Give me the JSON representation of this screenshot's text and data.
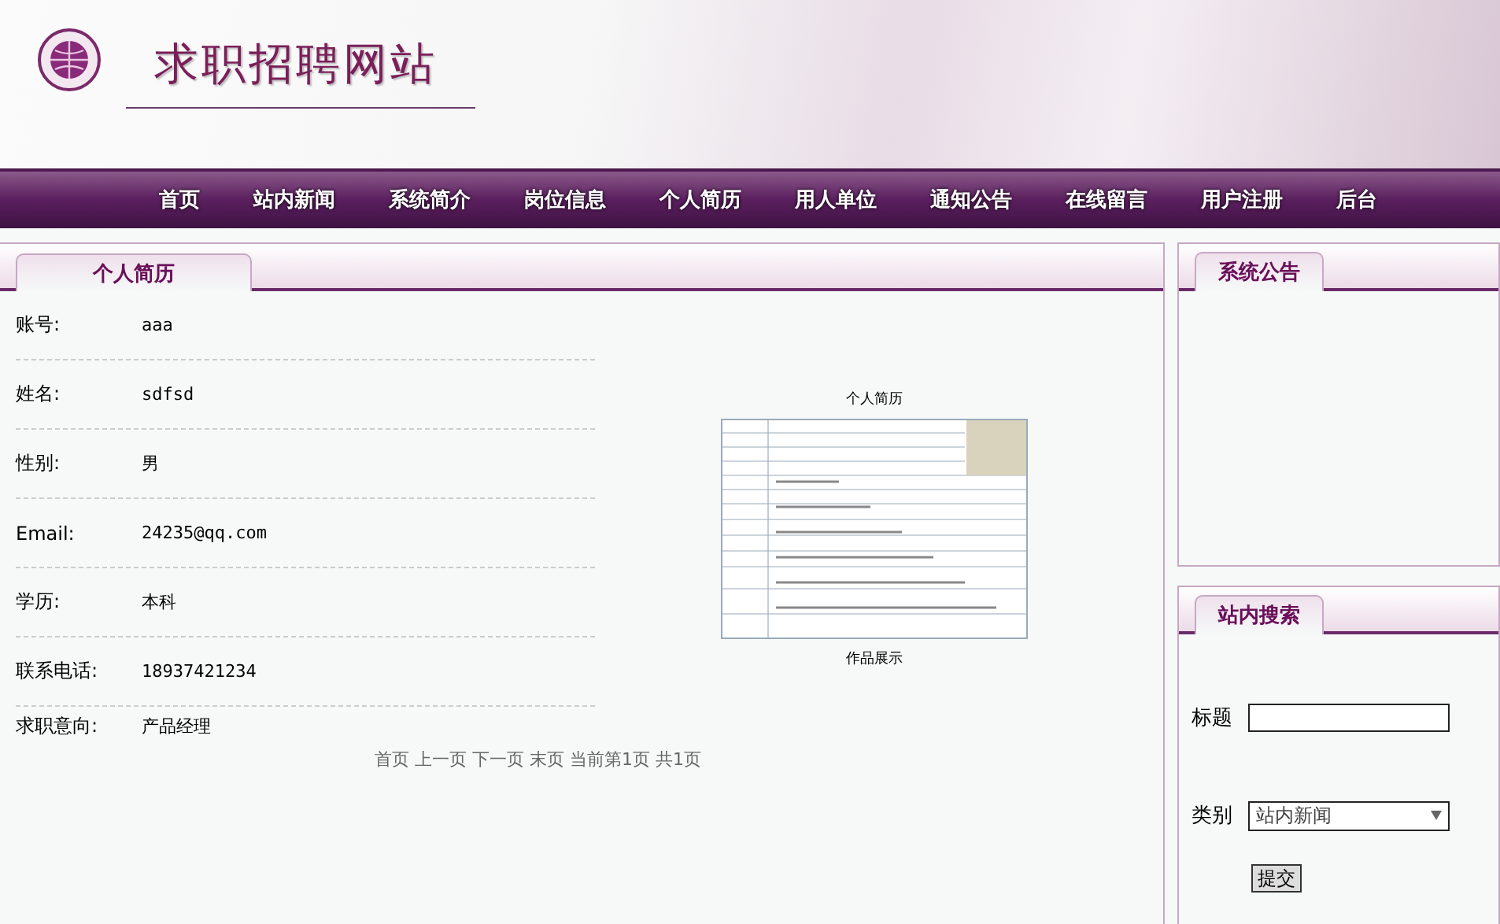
{
  "site": {
    "title": "求职招聘网站"
  },
  "nav": {
    "items": [
      {
        "label": "首页"
      },
      {
        "label": "站内新闻"
      },
      {
        "label": "系统简介"
      },
      {
        "label": "岗位信息"
      },
      {
        "label": "个人简历"
      },
      {
        "label": "用人单位"
      },
      {
        "label": "通知公告"
      },
      {
        "label": "在线留言"
      },
      {
        "label": "用户注册"
      },
      {
        "label": "后台"
      }
    ]
  },
  "main_panel": {
    "tab": "个人简历",
    "fields": [
      {
        "label": "账号:",
        "value": "aaa"
      },
      {
        "label": "姓名:",
        "value": "sdfsd"
      },
      {
        "label": "性别:",
        "value": "男"
      },
      {
        "label": "Email:",
        "value": "24235@qq.com"
      },
      {
        "label": "学历:",
        "value": "本科"
      },
      {
        "label": "联系电话:",
        "value": "18937421234"
      },
      {
        "label": "求职意向:",
        "value": "产品经理"
      }
    ],
    "resume_image": {
      "title": "个人简历",
      "caption": "作品展示"
    },
    "pagination": "首页 上一页 下一页 末页 当前第1页 共1页"
  },
  "notice_panel": {
    "tab": "系统公告"
  },
  "search_panel": {
    "tab": "站内搜索",
    "title_label": "标题",
    "category_label": "类别",
    "category_value": "站内新闻",
    "submit": "提交"
  }
}
